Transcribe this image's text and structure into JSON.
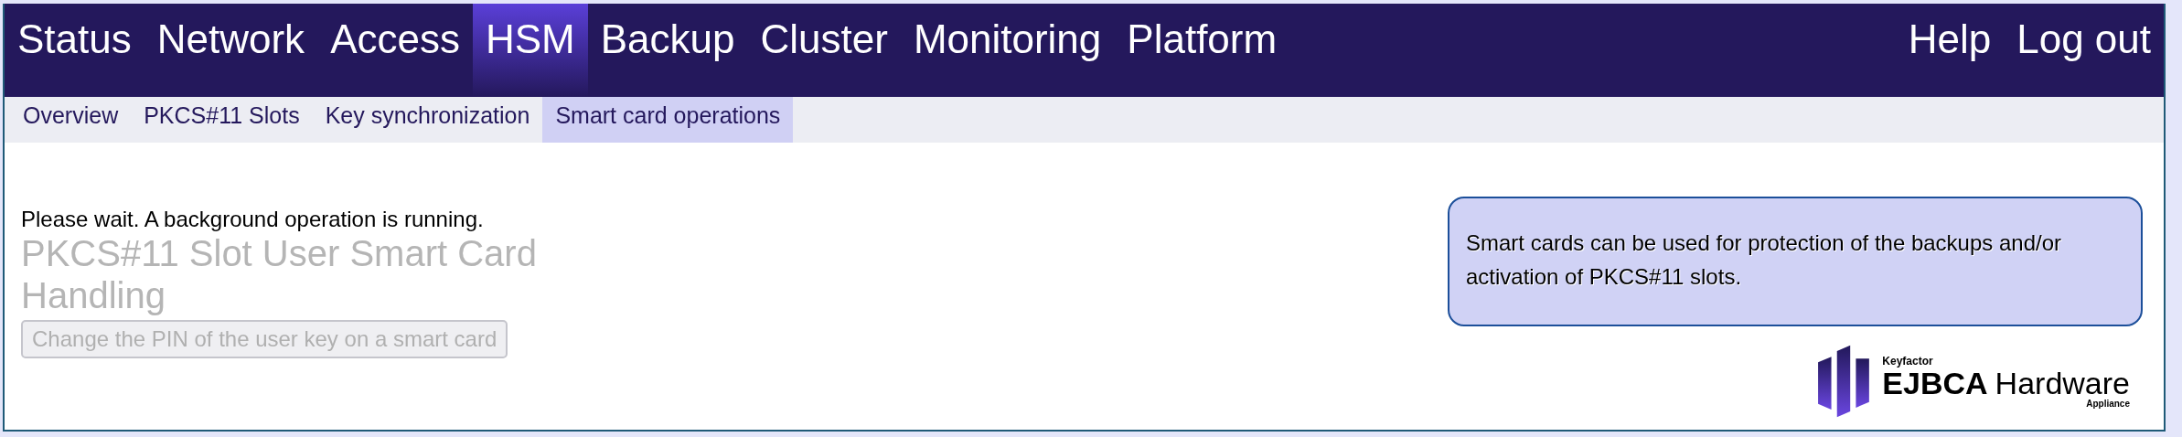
{
  "nav": {
    "items": [
      {
        "label": "Status",
        "selected": false
      },
      {
        "label": "Network",
        "selected": false
      },
      {
        "label": "Access",
        "selected": false
      },
      {
        "label": "HSM",
        "selected": true
      },
      {
        "label": "Backup",
        "selected": false
      },
      {
        "label": "Cluster",
        "selected": false
      },
      {
        "label": "Monitoring",
        "selected": false
      },
      {
        "label": "Platform",
        "selected": false
      }
    ],
    "right_items": [
      {
        "label": "Help"
      },
      {
        "label": "Log out"
      }
    ]
  },
  "subnav": {
    "items": [
      {
        "label": "Overview",
        "selected": false
      },
      {
        "label": "PKCS#11 Slots",
        "selected": false
      },
      {
        "label": "Key synchronization",
        "selected": false
      },
      {
        "label": "Smart card operations",
        "selected": true
      }
    ]
  },
  "content": {
    "notice": "Please wait. A background operation is running.",
    "heading": "PKCS#11 Slot User Smart Card Handling",
    "heading_disabled": true,
    "button": {
      "label": "Change the PIN of the user key on a smart card",
      "disabled": true
    }
  },
  "info_box": {
    "text": "Smart cards can be used for protection of the backups and/or activation of PKCS#11 slots."
  },
  "logo": {
    "brand": "Keyfactor",
    "product": "EJBCA",
    "product_suffix": "Hardware",
    "edition": "Appliance"
  }
}
